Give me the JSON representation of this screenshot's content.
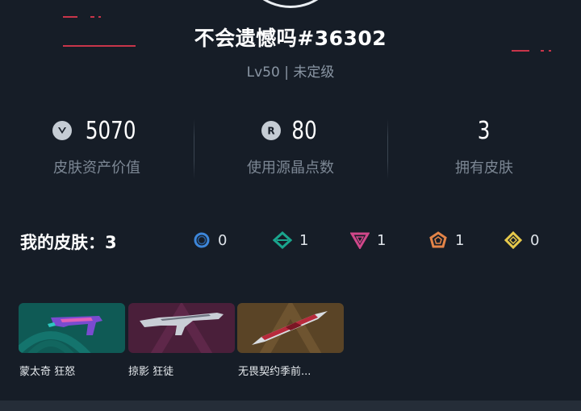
{
  "profile": {
    "username": "不会遗憾吗#36302",
    "level": "Lv50 | 未定级"
  },
  "stats": [
    {
      "value": "5070",
      "label": "皮肤资产价值",
      "icon": "valorant-points-icon"
    },
    {
      "value": "80",
      "label": "使用源晶点数",
      "icon": "radianite-points-icon"
    },
    {
      "value": "3",
      "label": "拥有皮肤",
      "icon": ""
    }
  ],
  "skins": {
    "title": "我的皮肤：3",
    "tiers": [
      {
        "icon": "select-tier-icon",
        "count": "0",
        "color": "#3d86d9"
      },
      {
        "icon": "deluxe-tier-icon",
        "count": "1",
        "color": "#1aa58d"
      },
      {
        "icon": "premium-tier-icon",
        "count": "1",
        "color": "#d0478a"
      },
      {
        "icon": "exclusive-tier-icon",
        "count": "1",
        "color": "#e38448"
      },
      {
        "icon": "ultra-tier-icon",
        "count": "0",
        "color": "#e6c94b"
      }
    ],
    "items": [
      {
        "name": "蒙太奇 狂怒",
        "bg": "#0f5a55"
      },
      {
        "name": "掠影 狂徒",
        "bg": "#4a1f3a"
      },
      {
        "name": "无畏契约季前...",
        "bg": "#5a4426"
      }
    ]
  }
}
